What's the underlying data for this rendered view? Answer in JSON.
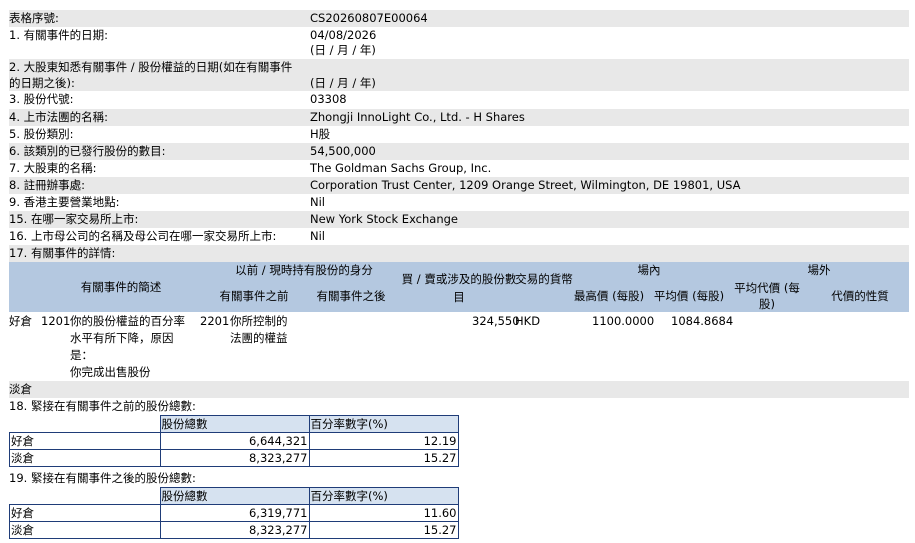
{
  "form": {
    "serial": {
      "label": "表格序號:",
      "value": "CS20260807E00064"
    },
    "item1": {
      "label": "1. 有關事件的日期:",
      "value": "04/08/2026",
      "note": "(日 / 月 / 年)"
    },
    "item2": {
      "label_line1": "2. 大股東知悉有關事件 / 股份權益的日期(如在有關事件",
      "label_line2": "的日期之後):",
      "note": "(日 / 月 / 年)"
    },
    "item3": {
      "label": "3. 股份代號:",
      "value": "03308"
    },
    "item4": {
      "label": "4. 上市法團的名稱:",
      "value": "Zhongji InnoLight Co., Ltd. - H Shares"
    },
    "item5": {
      "label": "5. 股份類別:",
      "value": "H股"
    },
    "item6": {
      "label": "6. 該類別的已發行股份的數目:",
      "value": "54,500,000"
    },
    "item7": {
      "label": "7. 大股東的名稱:",
      "value": "The Goldman Sachs Group, Inc."
    },
    "item8": {
      "label": "8. 註冊辦事處:",
      "value": "Corporation Trust Center, 1209 Orange Street, Wilmington, DE 19801, USA"
    },
    "item9": {
      "label": "9. 香港主要營業地點:",
      "value": "Nil"
    },
    "item15": {
      "label": "15. 在哪一家交易所上市:",
      "value": "New York Stock Exchange"
    },
    "item16": {
      "label": "16. 上市母公司的名稱及母公司在哪一家交易所上市:",
      "value": "Nil"
    },
    "item17": {
      "label": "17. 有關事件的詳情:"
    }
  },
  "event_table": {
    "headers": {
      "event_desc": "有關事件的簡述",
      "capacity": "以前 / 現時持有股份的身分",
      "before": "有關事件之前",
      "after": "有關事件之後",
      "shares": "買 / 賣或涉及的股份數目",
      "currency": "交易的貨幣",
      "onex": "場內",
      "highest": "最高價 (每股)",
      "average": "平均價 (每股)",
      "offex": "場外",
      "avg_consideration": "平均代價 (每股)",
      "nature": "代價的性質"
    },
    "long_label": "好倉",
    "row": {
      "code": "1201",
      "desc_line1": "你的股份權益的百分率",
      "desc_line2": "水平有所下降，原因",
      "desc_line3": "是：",
      "desc_line4": "你完成出售股份",
      "cap_code": "2201",
      "cap_line1": "你所控制的",
      "cap_line2": "法團的權益",
      "shares": "324,550",
      "currency": "HKD",
      "highest": "1100.0000",
      "average": "1084.8684"
    },
    "short_label": "淡倉"
  },
  "item18": {
    "label": "18. 緊接在有關事件之前的股份總數:",
    "col_total": "股份總數",
    "col_pct": "百分率數字(%)",
    "rows": [
      {
        "type": "好倉",
        "total": "6,644,321",
        "pct": "12.19"
      },
      {
        "type": "淡倉",
        "total": "8,323,277",
        "pct": "15.27"
      }
    ]
  },
  "item19": {
    "label": "19. 緊接在有關事件之後的股份總數:",
    "col_total": "股份總數",
    "col_pct": "百分率數字(%)",
    "rows": [
      {
        "type": "好倉",
        "total": "6,319,771",
        "pct": "11.60"
      },
      {
        "type": "淡倉",
        "total": "8,323,277",
        "pct": "15.27"
      }
    ]
  }
}
